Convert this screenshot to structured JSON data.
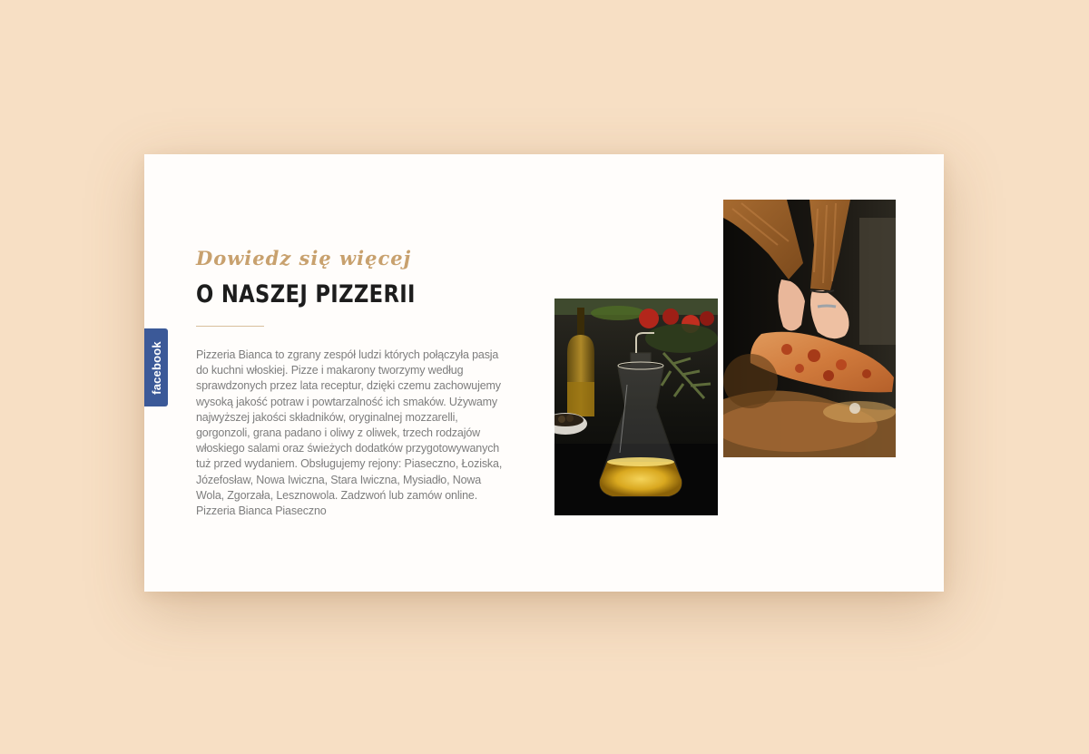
{
  "social": {
    "facebook_label": "facebook"
  },
  "about": {
    "subtitle": "Dowiedz się więcej",
    "title": "O NASZEJ PIZZERII",
    "description": "Pizzeria Bianca to zgrany zespół ludzi których połączyła pasja do kuchni włoskiej. Pizze i makarony tworzymy według sprawdzonych przez lata receptur, dzięki czemu zachowujemy wysoką jakość potraw i powtarzalność ich smaków. Używamy najwyższej jakości składników, oryginalnej mozzarelli, gorgonzoli, grana padano i oliwy z oliwek, trzech rodzajów włoskiego salami oraz świeżych dodatków przygotowywanych tuż przed wydaniem. Obsługujemy rejony: Piaseczno, Łoziska, Józefosław, Nowa Iwiczna, Stara Iwiczna, Mysiadło, Nowa Wola, Zgorzała, Lesznowola. Zadzwoń lub zamów online. Pizzeria Bianca Piaseczno"
  },
  "images": {
    "oil": "olive-oil-photo",
    "pizza": "pizza-hands-photo"
  },
  "colors": {
    "page_background": "#f7dfc4",
    "card_background": "#fffdfb",
    "accent_gold": "#c8a16e",
    "heading": "#1d1d1d",
    "body_text": "#7d7d7d",
    "facebook_blue": "#3b5998"
  }
}
